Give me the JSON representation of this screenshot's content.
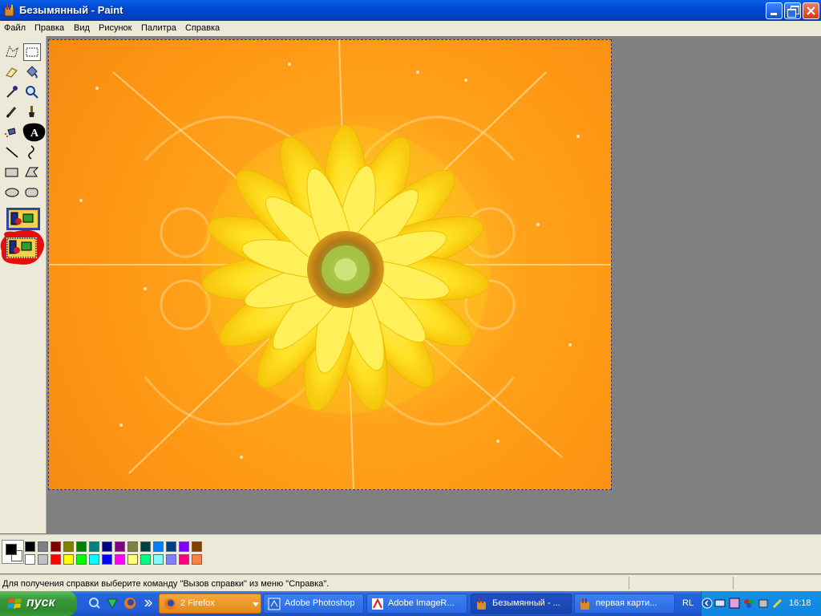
{
  "window": {
    "title": "Безымянный - Paint",
    "buttons": {
      "minimize": "_",
      "maximize": "□",
      "close": "✕"
    }
  },
  "menu": [
    "Файл",
    "Правка",
    "Вид",
    "Рисунок",
    "Палитра",
    "Справка"
  ],
  "tools": [
    {
      "name": "free-select",
      "icon": "free-form-select-icon"
    },
    {
      "name": "select",
      "icon": "rect-select-icon",
      "selected": true
    },
    {
      "name": "eraser",
      "icon": "eraser-icon"
    },
    {
      "name": "fill",
      "icon": "paint-bucket-icon"
    },
    {
      "name": "picker",
      "icon": "eyedropper-icon"
    },
    {
      "name": "magnifier",
      "icon": "magnifier-icon"
    },
    {
      "name": "pencil",
      "icon": "pencil-icon"
    },
    {
      "name": "brush",
      "icon": "brush-icon"
    },
    {
      "name": "airbrush",
      "icon": "airbrush-icon"
    },
    {
      "name": "text",
      "icon": "text-icon"
    },
    {
      "name": "line",
      "icon": "line-icon"
    },
    {
      "name": "curve",
      "icon": "curve-icon"
    },
    {
      "name": "rectangle",
      "icon": "rectangle-icon"
    },
    {
      "name": "polygon",
      "icon": "polygon-icon"
    },
    {
      "name": "ellipse",
      "icon": "ellipse-icon"
    },
    {
      "name": "rounded-rect",
      "icon": "rounded-rectangle-icon"
    }
  ],
  "palette": {
    "foreground": "#000000",
    "background": "#ffffff",
    "colors_top": [
      "#000000",
      "#808080",
      "#800000",
      "#808000",
      "#008000",
      "#008080",
      "#000080",
      "#800080",
      "#808040",
      "#004040",
      "#0080ff",
      "#004080",
      "#8000ff",
      "#804000"
    ],
    "colors_bottom": [
      "#ffffff",
      "#c0c0c0",
      "#ff0000",
      "#ffff00",
      "#00ff00",
      "#00ffff",
      "#0000ff",
      "#ff00ff",
      "#ffff80",
      "#00ff80",
      "#80ffff",
      "#8080ff",
      "#ff0080",
      "#ff8040"
    ]
  },
  "status": {
    "text": "Для получения справки выберите команду \"Вызов справки\" из меню \"Справка\"."
  },
  "taskbar": {
    "start_label": "пуск",
    "tasks": [
      {
        "label": "2 Firefox",
        "icon": "firefox-icon",
        "style": "ff"
      },
      {
        "label": "Adobe Photoshop",
        "icon": "photoshop-icon",
        "style": "normal"
      },
      {
        "label": "Adobe ImageR...",
        "icon": "imageready-icon",
        "style": "normal"
      },
      {
        "label": "Безымянный - ...",
        "icon": "paint-icon",
        "style": "active"
      },
      {
        "label": "первая карти...",
        "icon": "paint-icon",
        "style": "normal"
      }
    ],
    "language": "RL",
    "clock": "16:18"
  },
  "colors": {
    "title_blue": "#0048d0",
    "taskbar_blue": "#245edb",
    "start_green": "#3a9c3a",
    "face": "#ece9d8",
    "workspace_grey": "#808080"
  }
}
